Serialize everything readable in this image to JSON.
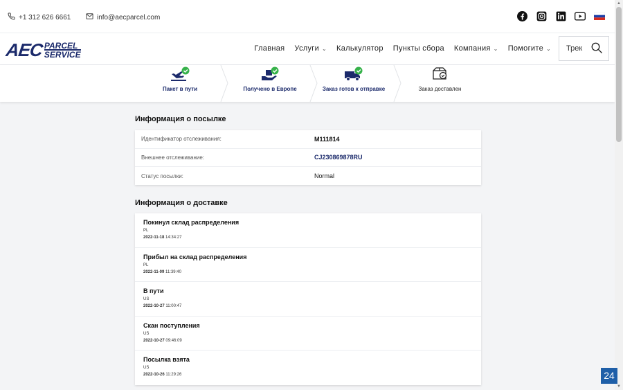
{
  "topbar": {
    "phone": "+1 312 626 6661",
    "email": "info@aecparcel.com",
    "socials": [
      "facebook-icon",
      "instagram-icon",
      "linkedin-icon",
      "youtube-icon",
      "russian-flag-icon"
    ]
  },
  "logo": {
    "main": "AEC",
    "line1": "PARCEL",
    "line2": "SERVICE"
  },
  "nav": {
    "items": [
      {
        "label": "Главная"
      },
      {
        "label": "Услуги"
      },
      {
        "label": "Калькулятор"
      },
      {
        "label": "Пункты сбора"
      },
      {
        "label": "Компания"
      },
      {
        "label": "Помогите"
      }
    ],
    "search_label": "Трек"
  },
  "steps": [
    {
      "label": "Пакет в пути",
      "icon": "plane-check-icon"
    },
    {
      "label": "Получено в Европе",
      "icon": "hand-package-check-icon"
    },
    {
      "label": "Заказ готов к отправке",
      "icon": "truck-check-icon"
    },
    {
      "label": "Заказ доставлен",
      "icon": "box-check-icon"
    }
  ],
  "parcel_info": {
    "title": "Информация о посылке",
    "rows": [
      {
        "label": "Идентификатор отслеживания:",
        "value": "M111814"
      },
      {
        "label": "Внешнее отслеживание:",
        "value": "CJ230869878RU"
      },
      {
        "label": "Статус посылки:",
        "value": "Normal"
      }
    ]
  },
  "delivery_info": {
    "title": "Информация о доставке",
    "events": [
      {
        "title": "Покинул склад распределения",
        "country": "PL",
        "date": "2022-11-18",
        "time": "14:34:27"
      },
      {
        "title": "Прибыл на склад распределения",
        "country": "PL",
        "date": "2022-11-09",
        "time": "11:39:40"
      },
      {
        "title": "В пути",
        "country": "US",
        "date": "2022-10-27",
        "time": "11:00:47"
      },
      {
        "title": "Скан поступления",
        "country": "US",
        "date": "2022-10-27",
        "time": "09:46:09"
      },
      {
        "title": "Посылка взята",
        "country": "US",
        "date": "2022-10-26",
        "time": "11:29:26"
      }
    ]
  },
  "badge": "24",
  "colors": {
    "brand": "#1b2a6b",
    "check": "#36b24a",
    "badge": "#1f5fa8"
  }
}
